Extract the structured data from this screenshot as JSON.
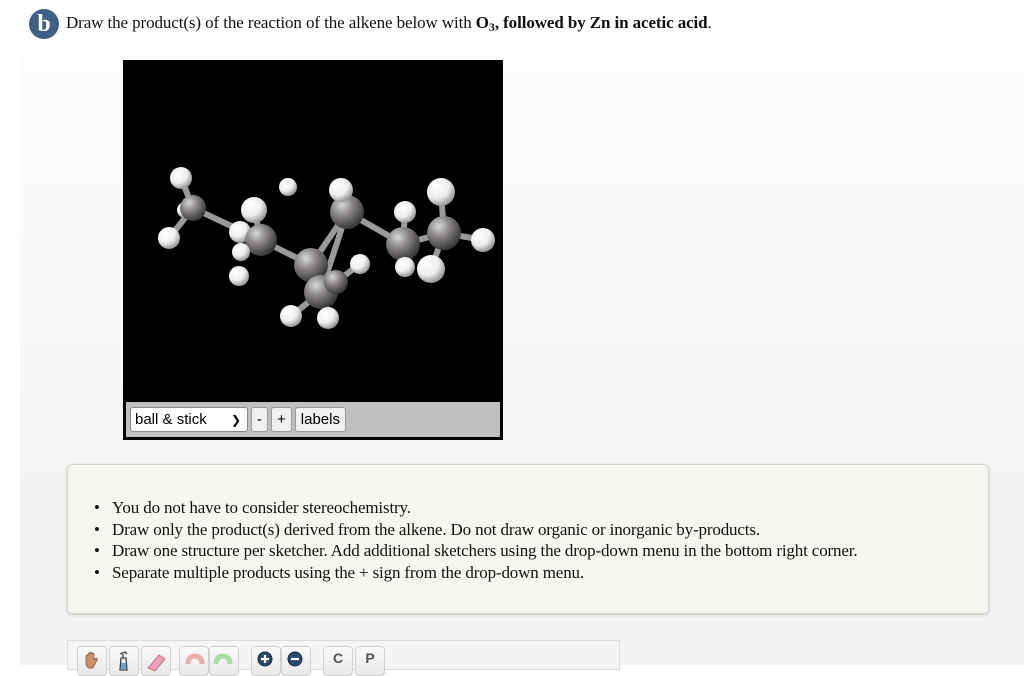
{
  "question": {
    "part_label": "b",
    "prompt_prefix": "Draw the product(s) of the reaction of the alkene below with ",
    "reagent_1": "O",
    "reagent_1_subscript": "3",
    "reagent_2": ", followed by Zn in acetic acid",
    "prompt_suffix": "."
  },
  "viewer": {
    "render_style": "ball & stick",
    "zoom_out_label": "-",
    "zoom_in_label": "+",
    "labels_button": "labels",
    "molecule": "alkene (3D ball & stick model)"
  },
  "instructions": {
    "items": [
      "You do not have to consider stereochemistry.",
      "Draw only the product(s) derived from the alkene. Do not draw organic or inorganic by-products.",
      "Draw one structure per sketcher. Add additional sketchers using the drop-down menu in the bottom right corner.",
      "Separate multiple products using the + sign from the drop-down menu."
    ]
  },
  "sketcher": {
    "tools": [
      {
        "name": "hand-tool",
        "icon": "hand-icon"
      },
      {
        "name": "clean-tool",
        "icon": "spray-bottle-icon"
      },
      {
        "name": "erase-tool",
        "icon": "eraser-icon"
      },
      {
        "name": "undo-tool",
        "icon": "undo-icon"
      },
      {
        "name": "redo-tool",
        "icon": "redo-icon"
      },
      {
        "name": "zoom-in-tool",
        "icon": "zoom-in-icon"
      },
      {
        "name": "zoom-out-tool",
        "icon": "zoom-out-icon"
      },
      {
        "name": "carbon-tool",
        "label": "C"
      },
      {
        "name": "periodic-table-tool",
        "label": "P"
      }
    ]
  },
  "colors": {
    "badge": "#3f5f86",
    "viewer_background": "#000000",
    "carbon_atom": "#8a8a8a",
    "hydrogen_atom": "#f2f2f2",
    "instructions_background": "#f7f7f2"
  }
}
